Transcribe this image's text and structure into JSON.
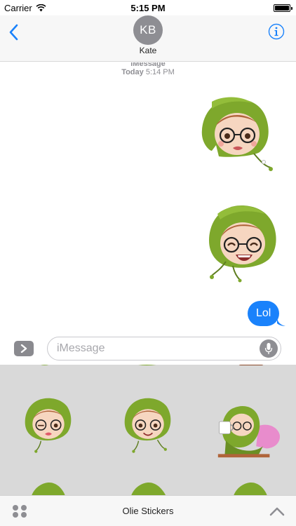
{
  "status_bar": {
    "carrier": "Carrier",
    "time": "5:15 PM",
    "battery_level": 1.0
  },
  "header": {
    "avatar_initials": "KB",
    "contact_name": "Kate",
    "back_icon": "chevron-left-icon",
    "info_icon": "info-icon"
  },
  "conversation": {
    "service_label": "iMessage",
    "timestamp_day": "Today",
    "timestamp_time": "5:14 PM",
    "messages": [
      {
        "type": "sticker",
        "from": "me",
        "sticker": "olie-sticker-pouting"
      },
      {
        "type": "sticker",
        "from": "me",
        "sticker": "olie-sticker-laughing"
      },
      {
        "type": "text",
        "from": "me",
        "text": "Lol"
      }
    ]
  },
  "input_bar": {
    "placeholder": "iMessage",
    "value": "",
    "apps_icon": "chevron-right-icon",
    "mic_icon": "microphone-icon"
  },
  "drawer": {
    "title": "Olie Stickers",
    "grid_icon": "app-grid-icon",
    "expand_icon": "chevron-up-icon"
  },
  "colors": {
    "accent": "#1a82fb",
    "bubble": "#1a82fb",
    "hood_green": "#7ea82c",
    "drawer_bg": "#d9d9d9",
    "header_bg": "#f7f7f7"
  }
}
